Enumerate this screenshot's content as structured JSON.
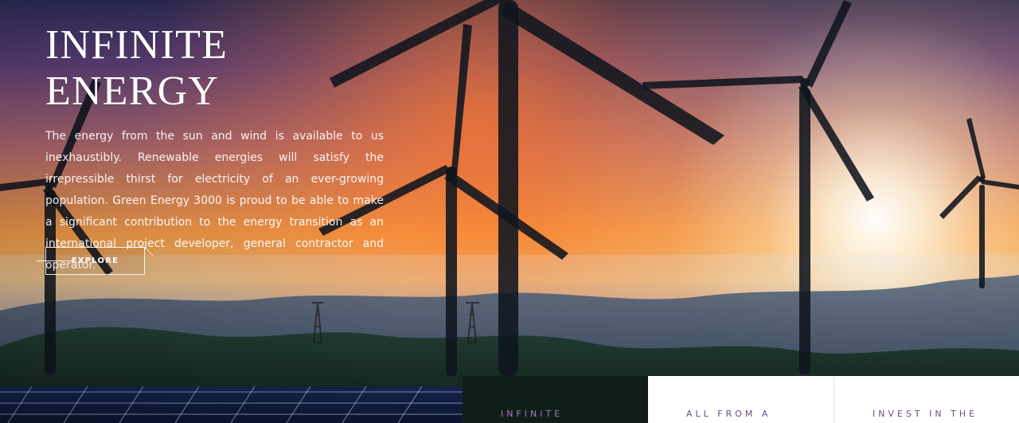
{
  "hero": {
    "title": "INFINITE ENERGY",
    "description": "The energy from the sun and wind is available to us inexhaustibly. Renewable energies will satisfy the irrepressible thirst for electricity of an ever-growing population. Green Energy 3000 is proud to be able to make a significant contribution to the energy transition as an international project developer, general contractor and operator.",
    "cta_label": "EXPLORE"
  },
  "cards": [
    {
      "label": "INFINITE"
    },
    {
      "label": "ALL FROM A"
    },
    {
      "label": "INVEST IN THE"
    }
  ],
  "colors": {
    "card_dark_bg": "#0f1f18",
    "card_dark_text": "#a775c1",
    "card_light_bg": "#ffffff",
    "card_light_text": "#6b4c86"
  }
}
